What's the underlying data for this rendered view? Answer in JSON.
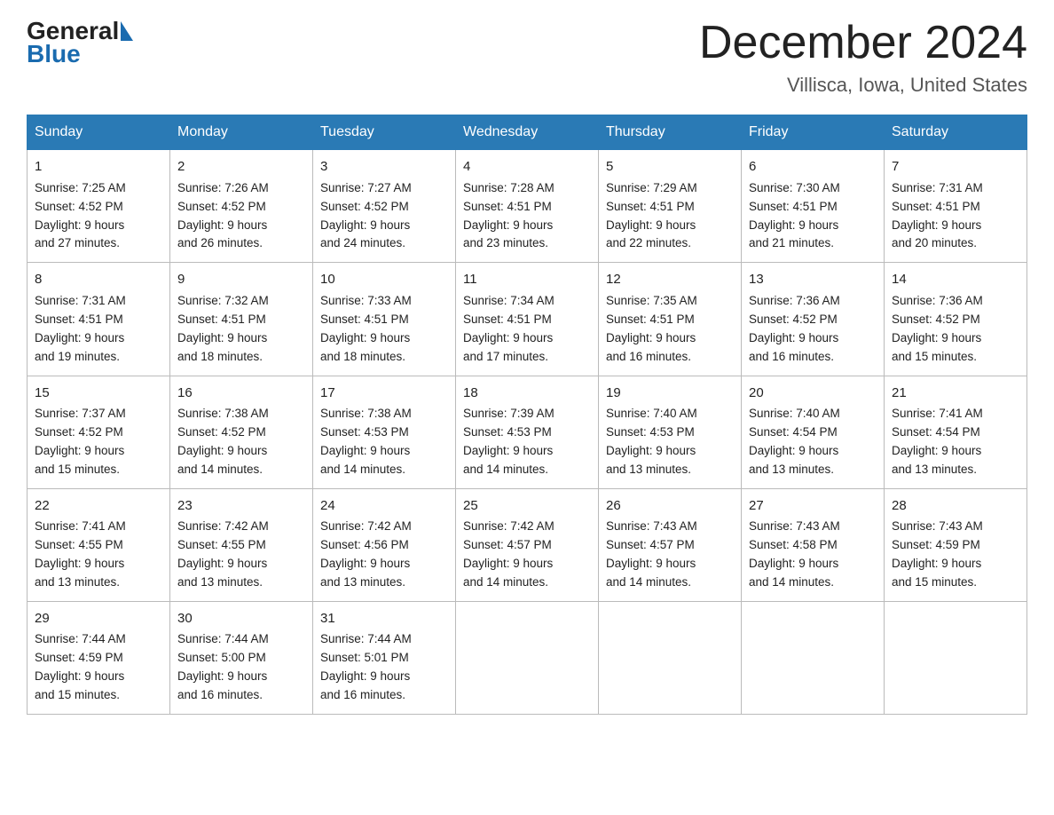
{
  "header": {
    "logo_general": "General",
    "logo_blue": "Blue",
    "title": "December 2024",
    "location": "Villisca, Iowa, United States"
  },
  "columns": [
    "Sunday",
    "Monday",
    "Tuesday",
    "Wednesday",
    "Thursday",
    "Friday",
    "Saturday"
  ],
  "weeks": [
    [
      {
        "day": "1",
        "sunrise": "7:25 AM",
        "sunset": "4:52 PM",
        "daylight": "9 hours and 27 minutes."
      },
      {
        "day": "2",
        "sunrise": "7:26 AM",
        "sunset": "4:52 PM",
        "daylight": "9 hours and 26 minutes."
      },
      {
        "day": "3",
        "sunrise": "7:27 AM",
        "sunset": "4:52 PM",
        "daylight": "9 hours and 24 minutes."
      },
      {
        "day": "4",
        "sunrise": "7:28 AM",
        "sunset": "4:51 PM",
        "daylight": "9 hours and 23 minutes."
      },
      {
        "day": "5",
        "sunrise": "7:29 AM",
        "sunset": "4:51 PM",
        "daylight": "9 hours and 22 minutes."
      },
      {
        "day": "6",
        "sunrise": "7:30 AM",
        "sunset": "4:51 PM",
        "daylight": "9 hours and 21 minutes."
      },
      {
        "day": "7",
        "sunrise": "7:31 AM",
        "sunset": "4:51 PM",
        "daylight": "9 hours and 20 minutes."
      }
    ],
    [
      {
        "day": "8",
        "sunrise": "7:31 AM",
        "sunset": "4:51 PM",
        "daylight": "9 hours and 19 minutes."
      },
      {
        "day": "9",
        "sunrise": "7:32 AM",
        "sunset": "4:51 PM",
        "daylight": "9 hours and 18 minutes."
      },
      {
        "day": "10",
        "sunrise": "7:33 AM",
        "sunset": "4:51 PM",
        "daylight": "9 hours and 18 minutes."
      },
      {
        "day": "11",
        "sunrise": "7:34 AM",
        "sunset": "4:51 PM",
        "daylight": "9 hours and 17 minutes."
      },
      {
        "day": "12",
        "sunrise": "7:35 AM",
        "sunset": "4:51 PM",
        "daylight": "9 hours and 16 minutes."
      },
      {
        "day": "13",
        "sunrise": "7:36 AM",
        "sunset": "4:52 PM",
        "daylight": "9 hours and 16 minutes."
      },
      {
        "day": "14",
        "sunrise": "7:36 AM",
        "sunset": "4:52 PM",
        "daylight": "9 hours and 15 minutes."
      }
    ],
    [
      {
        "day": "15",
        "sunrise": "7:37 AM",
        "sunset": "4:52 PM",
        "daylight": "9 hours and 15 minutes."
      },
      {
        "day": "16",
        "sunrise": "7:38 AM",
        "sunset": "4:52 PM",
        "daylight": "9 hours and 14 minutes."
      },
      {
        "day": "17",
        "sunrise": "7:38 AM",
        "sunset": "4:53 PM",
        "daylight": "9 hours and 14 minutes."
      },
      {
        "day": "18",
        "sunrise": "7:39 AM",
        "sunset": "4:53 PM",
        "daylight": "9 hours and 14 minutes."
      },
      {
        "day": "19",
        "sunrise": "7:40 AM",
        "sunset": "4:53 PM",
        "daylight": "9 hours and 13 minutes."
      },
      {
        "day": "20",
        "sunrise": "7:40 AM",
        "sunset": "4:54 PM",
        "daylight": "9 hours and 13 minutes."
      },
      {
        "day": "21",
        "sunrise": "7:41 AM",
        "sunset": "4:54 PM",
        "daylight": "9 hours and 13 minutes."
      }
    ],
    [
      {
        "day": "22",
        "sunrise": "7:41 AM",
        "sunset": "4:55 PM",
        "daylight": "9 hours and 13 minutes."
      },
      {
        "day": "23",
        "sunrise": "7:42 AM",
        "sunset": "4:55 PM",
        "daylight": "9 hours and 13 minutes."
      },
      {
        "day": "24",
        "sunrise": "7:42 AM",
        "sunset": "4:56 PM",
        "daylight": "9 hours and 13 minutes."
      },
      {
        "day": "25",
        "sunrise": "7:42 AM",
        "sunset": "4:57 PM",
        "daylight": "9 hours and 14 minutes."
      },
      {
        "day": "26",
        "sunrise": "7:43 AM",
        "sunset": "4:57 PM",
        "daylight": "9 hours and 14 minutes."
      },
      {
        "day": "27",
        "sunrise": "7:43 AM",
        "sunset": "4:58 PM",
        "daylight": "9 hours and 14 minutes."
      },
      {
        "day": "28",
        "sunrise": "7:43 AM",
        "sunset": "4:59 PM",
        "daylight": "9 hours and 15 minutes."
      }
    ],
    [
      {
        "day": "29",
        "sunrise": "7:44 AM",
        "sunset": "4:59 PM",
        "daylight": "9 hours and 15 minutes."
      },
      {
        "day": "30",
        "sunrise": "7:44 AM",
        "sunset": "5:00 PM",
        "daylight": "9 hours and 16 minutes."
      },
      {
        "day": "31",
        "sunrise": "7:44 AM",
        "sunset": "5:01 PM",
        "daylight": "9 hours and 16 minutes."
      },
      null,
      null,
      null,
      null
    ]
  ],
  "labels": {
    "sunrise": "Sunrise:",
    "sunset": "Sunset:",
    "daylight": "Daylight:"
  }
}
